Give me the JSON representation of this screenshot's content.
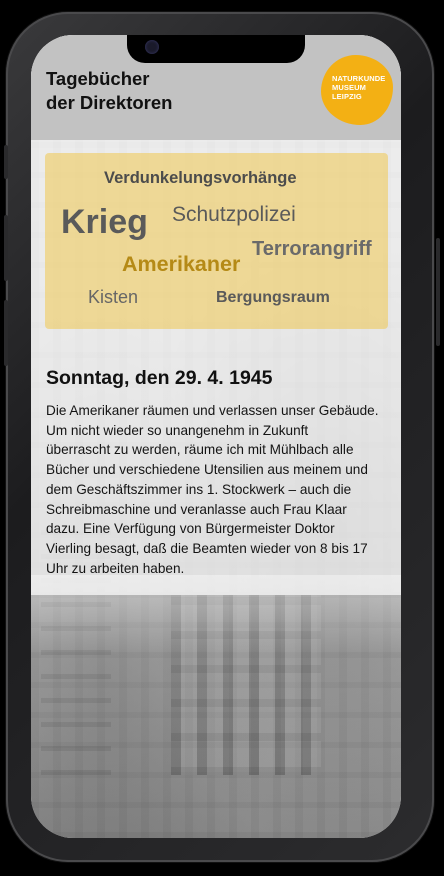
{
  "header": {
    "title_line1": "Tagebücher",
    "title_line2": "der Direktoren",
    "logo_lines": [
      "NATURKUNDE",
      "MUSEUM",
      "LEIPZIG"
    ]
  },
  "word_cloud": {
    "words": [
      {
        "text": "Verdunkelungsvorhänge"
      },
      {
        "text": "Krieg"
      },
      {
        "text": "Schutzpolizei"
      },
      {
        "text": "Terrorangriff"
      },
      {
        "text": "Amerikaner"
      },
      {
        "text": "Kisten"
      },
      {
        "text": "Bergungsraum"
      }
    ]
  },
  "entry": {
    "date": "Sonntag, den 29. 4. 1945",
    "lines": [
      "Die Amerikaner räumen und verlassen unser Gebäude.",
      "Um nicht wieder so unangenehm in Zukunft",
      "überrascht zu werden, räume ich mit Mühlbach alle",
      "Bücher und verschiedene Utensilien aus meinem und",
      "dem Geschäftszimmer ins 1. Stockwerk – auch die",
      "Schreibmaschine und veranlasse auch Frau Klaar",
      "dazu. Eine Verfügung von Bürgermeister Doktor",
      "Vierling besagt, daß die Beamten wieder von 8 bis 17",
      "Uhr zu arbeiten haben."
    ]
  },
  "colors": {
    "logo_accent": "#f3b014",
    "cloud_highlight": "#b58a16",
    "cloud_background": "#f0c850"
  }
}
